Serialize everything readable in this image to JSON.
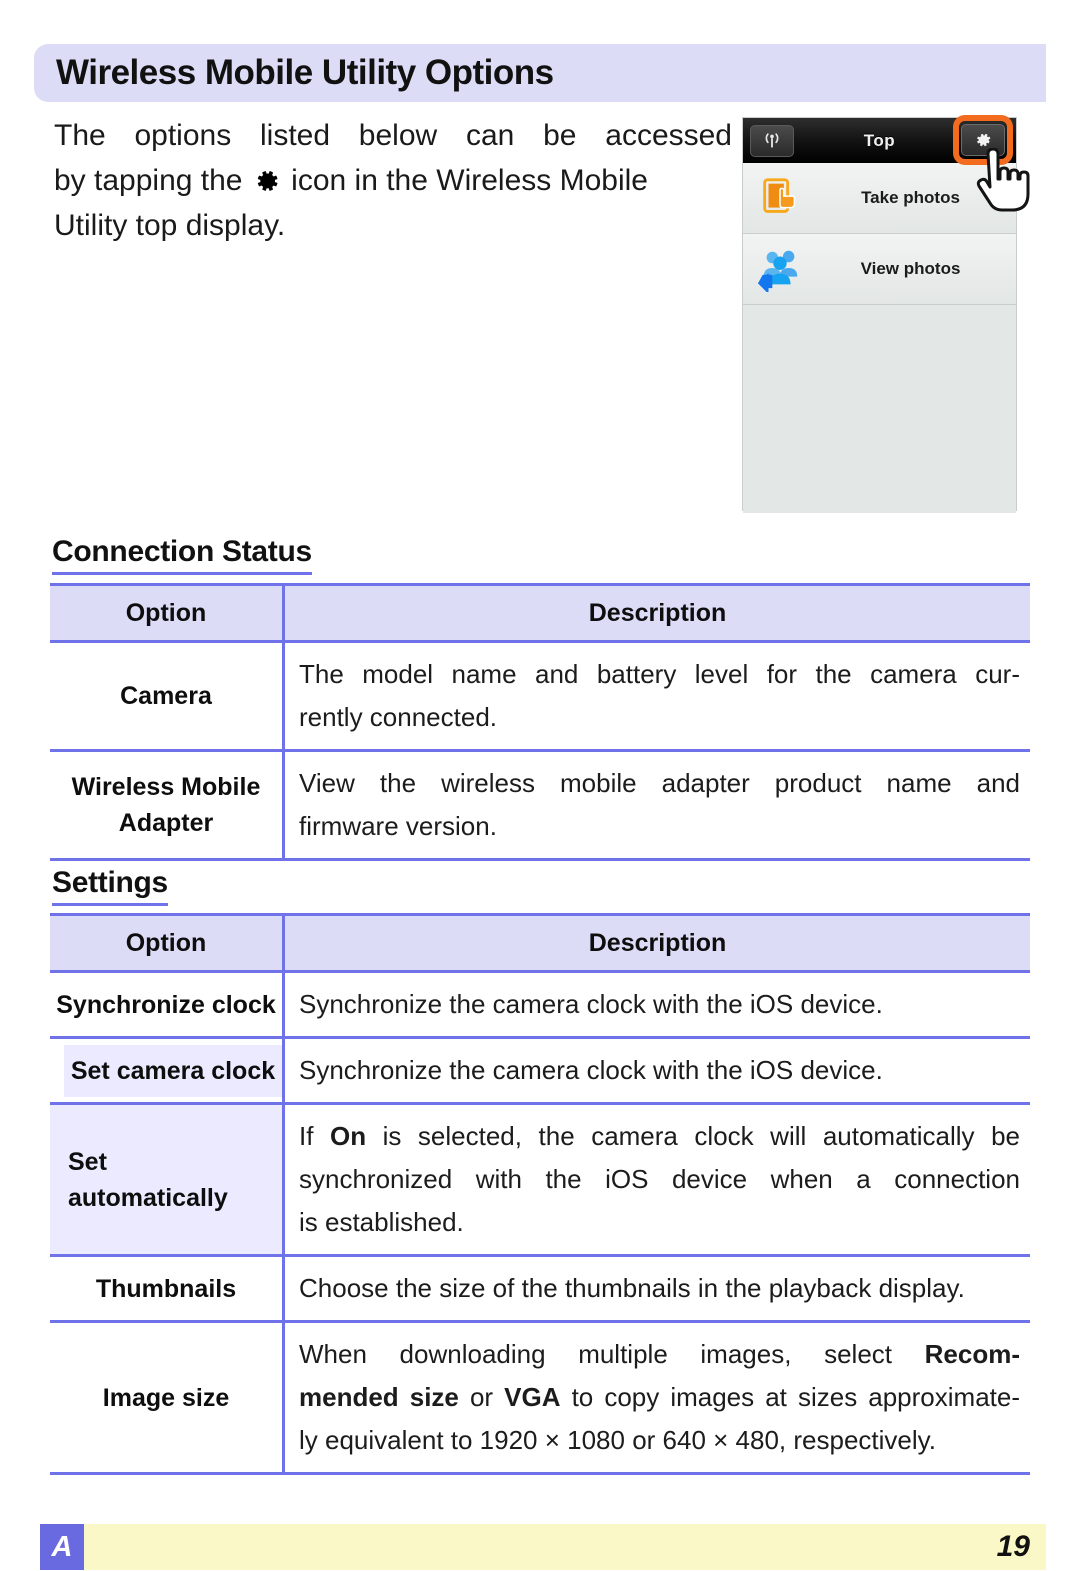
{
  "header": {
    "title": "Wireless Mobile Utility Options",
    "banner_color": "#dcdcf7"
  },
  "intro": {
    "line1": "The options listed below can be accessed",
    "line2_a": "by tapping the",
    "line2_icon": "gear-icon",
    "line2_b": "icon in the Wireless Mobile",
    "line3": "Utility top display."
  },
  "device_screenshot": {
    "toolbar_title": "Top",
    "wifi_icon": "wifi-antenna-icon",
    "gear_icon": "gear-icon",
    "highlight_color": "#f26b1e",
    "cursor_icon": "pointing-hand-cursor",
    "rows": [
      {
        "label": "Take photos",
        "icon": "phone-tap-icon"
      },
      {
        "label": "View photos",
        "icon": "people-group-icon"
      }
    ]
  },
  "sections": [
    {
      "heading": "Connection Status",
      "columns": {
        "option": "Option",
        "description": "Description"
      },
      "rows": [
        {
          "option": "Camera",
          "desc_lines": [
            "The model name and battery level for the camera cur-",
            "rently connected."
          ]
        },
        {
          "option_lines": [
            "Wireless Mobile",
            "Adapter"
          ],
          "desc_lines": [
            "View the wireless mobile adapter product name and",
            "firmware version."
          ]
        }
      ]
    },
    {
      "heading": "Settings",
      "columns": {
        "option": "Option",
        "description": "Description"
      },
      "rows": [
        {
          "option": "Synchronize clock",
          "desc_lines": [
            "Synchronize the camera clock with the iOS device."
          ]
        },
        {
          "option": "Set camera clock",
          "indented": true,
          "desc_lines": [
            "Synchronize the camera clock with the iOS device."
          ]
        },
        {
          "option_lines": [
            "Set",
            "automatically"
          ],
          "indented": true,
          "desc_rich": [
            {
              "parts": [
                {
                  "t": "If ",
                  "b": false
                },
                {
                  "t": "On",
                  "b": true
                },
                {
                  "t": " is selected, the camera clock will automatically be",
                  "b": false
                }
              ]
            },
            {
              "parts": [
                {
                  "t": "synchronized with the iOS device when a connection",
                  "b": false
                }
              ]
            },
            {
              "parts": [
                {
                  "t": "is established.",
                  "b": false
                }
              ]
            }
          ]
        },
        {
          "option": "Thumbnails",
          "desc_lines": [
            "Choose the size of the thumbnails in the playback display."
          ]
        },
        {
          "option": "Image size",
          "desc_rich": [
            {
              "parts": [
                {
                  "t": "When downloading multiple images, select ",
                  "b": false
                },
                {
                  "t": "Recom-",
                  "b": true
                }
              ]
            },
            {
              "parts": [
                {
                  "t": "mended size",
                  "b": true
                },
                {
                  "t": " or ",
                  "b": false
                },
                {
                  "t": "VGA",
                  "b": true
                },
                {
                  "t": " to copy images at sizes approximate-",
                  "b": false
                }
              ]
            },
            {
              "parts": [
                {
                  "t": "ly equivalent to 1920 × 1080 or 640 × 480, respectively.",
                  "b": false
                }
              ]
            }
          ]
        }
      ]
    }
  ],
  "footer": {
    "badge": "A",
    "page_number": "19",
    "band_color": "#fbf8c8",
    "badge_color": "#6a6ae0"
  }
}
